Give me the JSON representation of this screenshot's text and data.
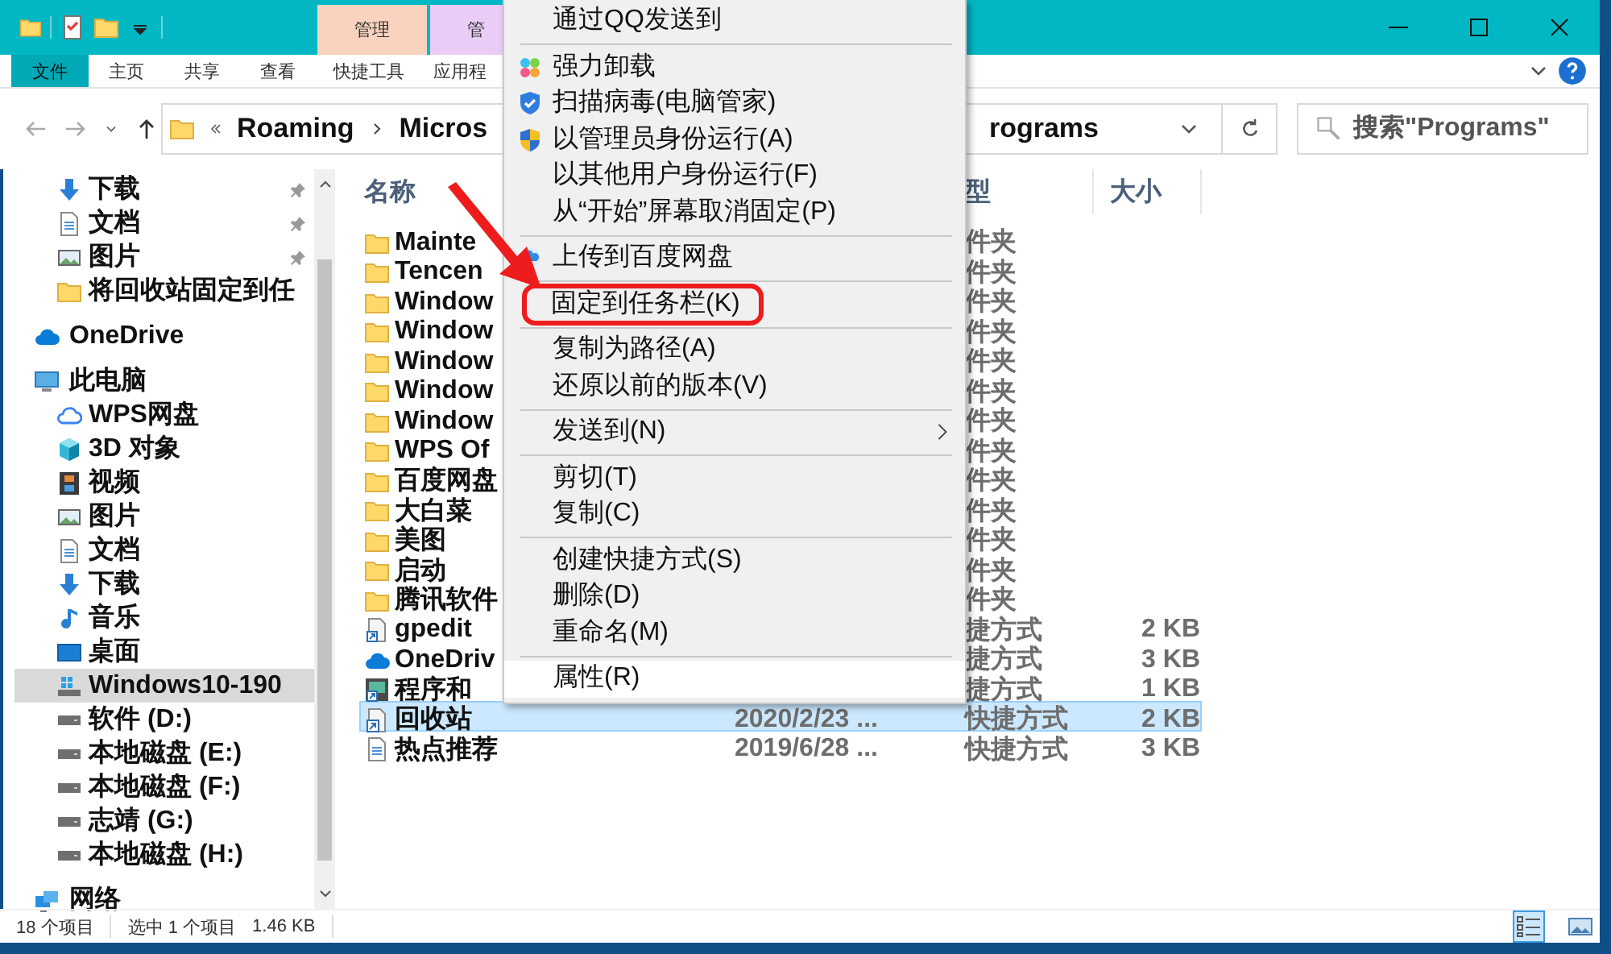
{
  "title_bar": {
    "context_tabs": [
      {
        "label": "管理",
        "color": "#f9d3bf"
      },
      {
        "label": "管",
        "color": "#e9cdf6"
      }
    ]
  },
  "ribbon": {
    "tabs": [
      {
        "label": "文件",
        "kind": "file",
        "selected": false
      },
      {
        "label": "主页",
        "kind": "tab",
        "selected": false
      },
      {
        "label": "共享",
        "kind": "tab",
        "selected": false
      },
      {
        "label": "查看",
        "kind": "tab",
        "selected": false
      },
      {
        "label": "快捷工具",
        "kind": "tab",
        "selected": false
      },
      {
        "label": "应用程",
        "kind": "tab",
        "selected": false
      }
    ]
  },
  "address_bar": {
    "crumbs": [
      "Roaming",
      "Micros",
      "rograms"
    ]
  },
  "search": {
    "placeholder": "搜索\"Programs\""
  },
  "sidebar": {
    "quick_access_items": [
      {
        "label": "下载",
        "kind": "downloads",
        "pinned": true,
        "selected": false
      },
      {
        "label": "文档",
        "kind": "documents",
        "pinned": true,
        "selected": false
      },
      {
        "label": "图片",
        "kind": "pictures",
        "pinned": true,
        "selected": false
      },
      {
        "label": "将回收站固定到任",
        "kind": "folder",
        "pinned": false,
        "selected": false
      }
    ],
    "tree": [
      {
        "label": "OneDrive",
        "kind": "onedrive",
        "selected": false
      },
      {
        "label": "此电脑",
        "kind": "computer",
        "selected": false,
        "children": [
          {
            "label": "WPS网盘",
            "kind": "netdisk",
            "selected": false
          },
          {
            "label": "3D 对象",
            "kind": "objects",
            "selected": false
          },
          {
            "label": "视频",
            "kind": "videos",
            "selected": false
          },
          {
            "label": "图片",
            "kind": "pictures",
            "selected": false
          },
          {
            "label": "文档",
            "kind": "documents",
            "selected": false
          },
          {
            "label": "下载",
            "kind": "downloads",
            "selected": false
          },
          {
            "label": "音乐",
            "kind": "music",
            "selected": false
          },
          {
            "label": "桌面",
            "kind": "desktop",
            "selected": false
          },
          {
            "label": "Windows10-190",
            "kind": "system",
            "selected": true
          },
          {
            "label": "软件 (D:)",
            "kind": "drive",
            "selected": false
          },
          {
            "label": "本地磁盘 (E:)",
            "kind": "drive",
            "selected": false
          },
          {
            "label": "本地磁盘 (F:)",
            "kind": "drive",
            "selected": false
          },
          {
            "label": "志靖 (G:)",
            "kind": "drive",
            "selected": false
          },
          {
            "label": "本地磁盘 (H:)",
            "kind": "drive",
            "selected": false
          }
        ]
      },
      {
        "label": "网络",
        "kind": "network",
        "selected": false
      }
    ]
  },
  "file_list": {
    "columns": [
      {
        "label": "名称",
        "kind": "name"
      },
      {
        "label": "型",
        "kind": "type"
      },
      {
        "label": "大小",
        "kind": "size"
      }
    ],
    "rows": [
      {
        "name": "Mainte",
        "kind": "folder",
        "type": "件夹",
        "selected": false
      },
      {
        "name": "Tencen",
        "kind": "folder",
        "type": "件夹",
        "selected": false
      },
      {
        "name": "Window",
        "kind": "folder",
        "type": "件夹",
        "selected": false
      },
      {
        "name": "Window",
        "kind": "folder",
        "type": "件夹",
        "selected": false
      },
      {
        "name": "Window",
        "kind": "folder",
        "type": "件夹",
        "selected": false
      },
      {
        "name": "Window",
        "kind": "folder",
        "type": "件夹",
        "selected": false
      },
      {
        "name": "Window",
        "kind": "folder",
        "type": "件夹",
        "selected": false
      },
      {
        "name": "WPS Of",
        "kind": "folder",
        "type": "件夹",
        "selected": false
      },
      {
        "name": "百度网盘",
        "kind": "folder",
        "type": "件夹",
        "selected": false
      },
      {
        "name": "大白菜",
        "kind": "folder",
        "type": "件夹",
        "selected": false
      },
      {
        "name": "美图",
        "kind": "folder",
        "type": "件夹",
        "selected": false
      },
      {
        "name": "启动",
        "kind": "folder",
        "type": "件夹",
        "selected": false
      },
      {
        "name": "腾讯软件",
        "kind": "folder",
        "type": "件夹",
        "selected": false
      },
      {
        "name": "gpedit",
        "kind": "script",
        "type": "捷方式",
        "size": "2 KB",
        "selected": false
      },
      {
        "name": "OneDriv",
        "kind": "onedrive",
        "type": "捷方式",
        "size": "3 KB",
        "selected": false
      },
      {
        "name": "程序和",
        "kind": "app",
        "type": "捷方式",
        "size": "1 KB",
        "selected": false
      },
      {
        "name": "回收站",
        "kind": "shortcut",
        "date": "2020/2/23 ...",
        "type": "快捷方式",
        "size": "2 KB",
        "selected": true
      },
      {
        "name": "热点推荐",
        "kind": "document",
        "date": "2019/6/28 ...",
        "type": "快捷方式",
        "size": "3 KB",
        "selected": false
      }
    ]
  },
  "context_menu": {
    "items": [
      {
        "kind": "plain",
        "label": "通过QQ发送到",
        "selected": false,
        "annotated": false
      },
      {
        "kind": "separator"
      },
      {
        "kind": "uninstall",
        "label": "强力卸载",
        "selected": false,
        "annotated": false
      },
      {
        "kind": "scan",
        "label": "扫描病毒(电脑管家)",
        "selected": false,
        "annotated": false
      },
      {
        "kind": "admin",
        "label": "以管理员身份运行(A)",
        "selected": false,
        "annotated": false
      },
      {
        "kind": "plain",
        "label": "以其他用户身份运行(F)",
        "selected": false,
        "annotated": false
      },
      {
        "kind": "plain",
        "label": "从“开始”屏幕取消固定(P)",
        "selected": false,
        "annotated": false
      },
      {
        "kind": "separator"
      },
      {
        "kind": "upload",
        "label": "上传到百度网盘",
        "selected": false,
        "annotated": false
      },
      {
        "kind": "separator"
      },
      {
        "kind": "plain",
        "label": "固定到任务栏(K)",
        "selected": false,
        "annotated": true
      },
      {
        "kind": "separator"
      },
      {
        "kind": "plain",
        "label": "复制为路径(A)",
        "selected": false,
        "annotated": false
      },
      {
        "kind": "plain",
        "label": "还原以前的版本(V)",
        "selected": false,
        "annotated": false
      },
      {
        "kind": "separator"
      },
      {
        "kind": "plain",
        "label": "发送到(N)",
        "submenu": true,
        "selected": false,
        "annotated": false
      },
      {
        "kind": "separator"
      },
      {
        "kind": "plain",
        "label": "剪切(T)",
        "selected": false,
        "annotated": false
      },
      {
        "kind": "plain",
        "label": "复制(C)",
        "selected": false,
        "annotated": false
      },
      {
        "kind": "separator"
      },
      {
        "kind": "plain",
        "label": "创建快捷方式(S)",
        "selected": false,
        "annotated": false
      },
      {
        "kind": "plain",
        "label": "删除(D)",
        "selected": false,
        "annotated": false
      },
      {
        "kind": "plain",
        "label": "重命名(M)",
        "selected": false,
        "annotated": false
      },
      {
        "kind": "separator"
      },
      {
        "kind": "plain",
        "label": "属性(R)",
        "selected": true,
        "annotated": false
      }
    ]
  },
  "status_bar": {
    "item_count": "18 个项目",
    "selection": "选中 1 个项目",
    "size": "1.46 KB",
    "views": [
      {
        "kind": "details",
        "selected": true
      },
      {
        "kind": "large",
        "selected": false
      }
    ]
  }
}
